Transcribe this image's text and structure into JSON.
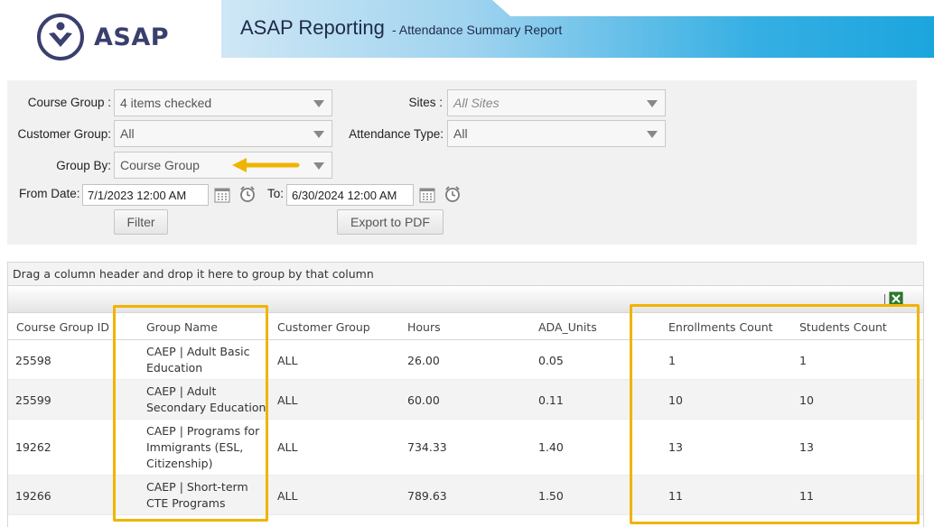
{
  "header": {
    "logo_text": "ASAP",
    "title": "ASAP Reporting",
    "subtitle": "- Attendance Summary Report"
  },
  "filters": {
    "course_group": {
      "label": "Course Group :",
      "value": "4 items checked"
    },
    "sites": {
      "label": "Sites :",
      "placeholder": "All Sites"
    },
    "customer_group": {
      "label": "Customer Group:",
      "value": "All"
    },
    "attendance_type": {
      "label": "Attendance Type:",
      "value": "All"
    },
    "group_by": {
      "label": "Group By:",
      "value": "Course Group"
    },
    "from_date": {
      "label": "From Date:",
      "value": "7/1/2023 12:00 AM"
    },
    "to_date": {
      "label": "To:",
      "value": "6/30/2024 12:00 AM"
    },
    "filter_button": "Filter",
    "export_button": "Export to PDF"
  },
  "grid": {
    "group_hint": "Drag a column header and drop it here to group by that column",
    "columns": [
      "Course Group ID",
      "Group Name",
      "Customer Group",
      "Hours",
      "ADA_Units",
      "Enrollments Count",
      "Students Count"
    ],
    "rows": [
      {
        "id": "25598",
        "name_lines": [
          "CAEP | Adult Basic",
          "Education"
        ],
        "customer_group": "ALL",
        "hours": "26.00",
        "ada_units": "0.05",
        "enrollments": "1",
        "students": "1"
      },
      {
        "id": "25599",
        "name_lines": [
          "CAEP | Adult",
          "Secondary Education"
        ],
        "customer_group": "ALL",
        "hours": "60.00",
        "ada_units": "0.11",
        "enrollments": "10",
        "students": "10"
      },
      {
        "id": "19262",
        "name_lines": [
          "CAEP | Programs for",
          "Immigrants (ESL,",
          "Citizenship)"
        ],
        "customer_group": "ALL",
        "hours": "734.33",
        "ada_units": "1.40",
        "enrollments": "13",
        "students": "13"
      },
      {
        "id": "19266",
        "name_lines": [
          "CAEP | Short-term",
          "CTE Programs"
        ],
        "customer_group": "ALL",
        "hours": "789.63",
        "ada_units": "1.50",
        "enrollments": "11",
        "students": "11"
      }
    ]
  },
  "colors": {
    "highlight": "#f0b400",
    "banner_accent": "#1ca5dd",
    "brand_navy": "#3a3f6e"
  },
  "icons": [
    "heart-logo-icon",
    "dropdown-caret-icon",
    "calendar-icon",
    "clock-icon",
    "excel-export-icon",
    "arrow-annotation-icon"
  ]
}
